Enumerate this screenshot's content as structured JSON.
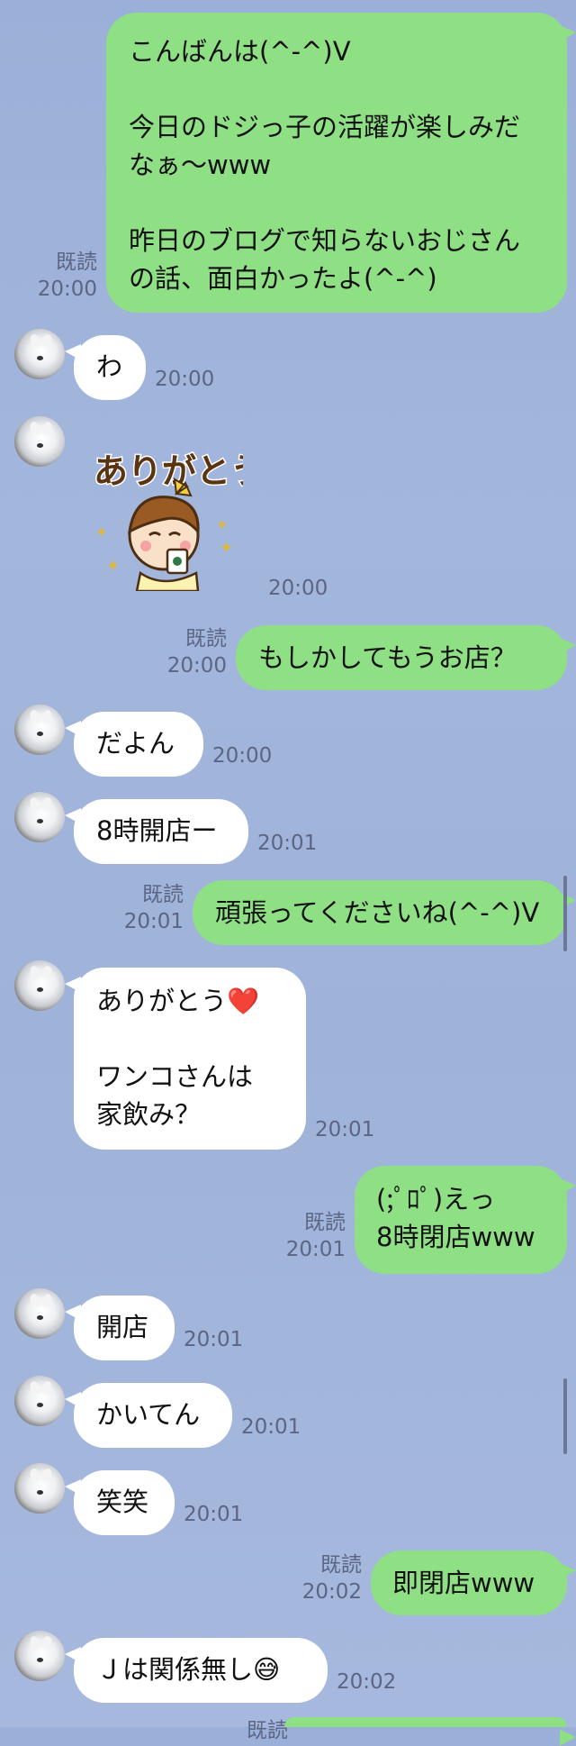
{
  "messages": [
    {
      "side": "sent",
      "text": "こんばんは(^-^)V\n\n今日のドジっ子の活躍が楽しみだなぁ〜www\n\n昨日のブログで知らないおじさんの話、面白かったよ(^-^)",
      "read": "既読",
      "time": "20:00"
    },
    {
      "side": "recv",
      "text": "わ",
      "time": "20:00"
    },
    {
      "side": "recv",
      "sticker": "sticker-arigatou-girl",
      "sticker_text": "ありがとう",
      "time": "20:00"
    },
    {
      "side": "sent",
      "text": "もしかしてもうお店？",
      "read": "既読",
      "time": "20:00"
    },
    {
      "side": "recv",
      "text": "だよん",
      "time": "20:00"
    },
    {
      "side": "recv",
      "text": "8時開店ー",
      "time": "20:01"
    },
    {
      "side": "sent",
      "text": "頑張ってくださいね(^-^)V",
      "read": "既読",
      "time": "20:01"
    },
    {
      "side": "recv",
      "text": "ありがとう❤️\n\nワンコさんは\n家飲み？",
      "time": "20:01"
    },
    {
      "side": "sent",
      "text": "(;ﾟﾛﾟ)えっ\n8時閉店www",
      "read": "既読",
      "time": "20:01"
    },
    {
      "side": "recv",
      "text": "開店",
      "time": "20:01"
    },
    {
      "side": "recv",
      "text": "かいてん",
      "time": "20:01"
    },
    {
      "side": "recv",
      "text": "笑笑",
      "time": "20:01"
    },
    {
      "side": "sent",
      "text": "即閉店www",
      "read": "既読",
      "time": "20:02"
    },
    {
      "side": "recv",
      "text": "Ｊは関係無し😅",
      "time": "20:02"
    },
    {
      "side": "sent",
      "text": "",
      "read": "既読",
      "time": ""
    }
  ],
  "colors": {
    "sent_bubble": "#8fdf85",
    "recv_bubble": "#ffffff",
    "background": "#9fb3da",
    "meta": "#5b6584"
  },
  "icons": {
    "avatar": "dog-avatar-icon",
    "scrollbar": "scrollbar"
  }
}
